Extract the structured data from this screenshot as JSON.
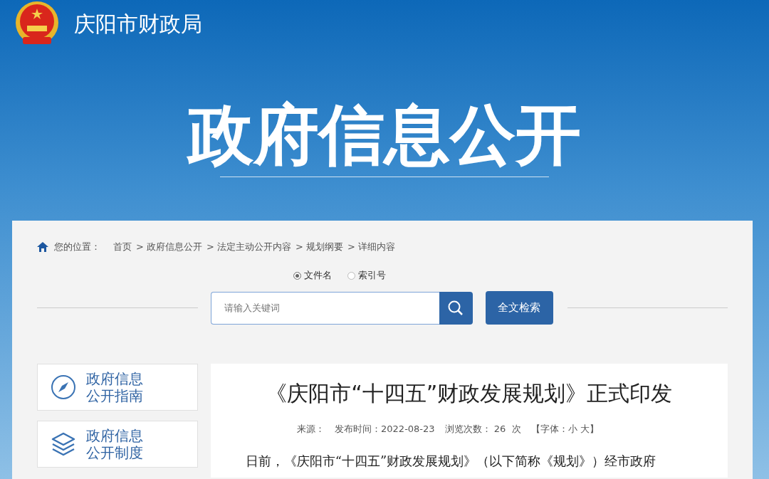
{
  "header": {
    "site_title": "庆阳市财政局",
    "banner_title": "政府信息公开"
  },
  "breadcrumb": {
    "label": "您的位置：",
    "items": [
      {
        "text": "首页"
      },
      {
        "text": "> 政府信息公开"
      },
      {
        "text": "> 法定主动公开内容"
      },
      {
        "text": "> 规划纲要"
      },
      {
        "text": "> 详细内容"
      }
    ]
  },
  "search_type": [
    {
      "label": "文件名",
      "selected": true
    },
    {
      "label": "索引号",
      "selected": false
    }
  ],
  "search": {
    "placeholder": "请输入关键词",
    "button": "全文检索"
  },
  "sidebar": {
    "items": [
      {
        "kind": "compass",
        "line1": "政府信息",
        "line2": "公开指南"
      },
      {
        "kind": "layers",
        "line1": "政府信息",
        "line2": "公开制度"
      }
    ]
  },
  "article": {
    "title": "《庆阳市“十四五”财政发展规划》正式印发",
    "meta": [
      "来源：",
      "发布时间：2022-08-23",
      "浏览次数： 26  次",
      "【字体：小 大】"
    ],
    "body": "日前，《庆阳市“十四五”财政发展规划》（以下简称《规划》）经市政府"
  }
}
